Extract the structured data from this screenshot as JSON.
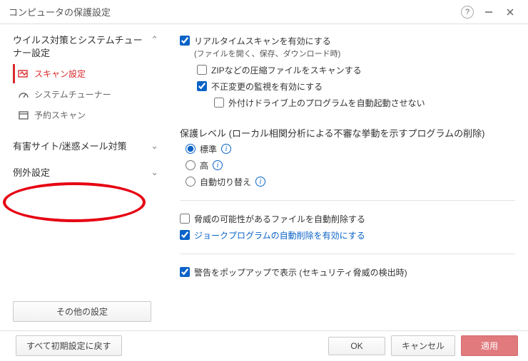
{
  "window": {
    "title": "コンピュータの保護設定"
  },
  "sidebar": {
    "group1": "ウイルス対策とシステムチューナー設定",
    "items": [
      {
        "label": "スキャン設定"
      },
      {
        "label": "システムチューナー"
      },
      {
        "label": "予約スキャン"
      }
    ],
    "group2": "有害サイト/迷惑メール対策",
    "group3": "例外設定",
    "other_button": "その他の設定"
  },
  "main": {
    "realtime": "リアルタイムスキャンを有効にする",
    "realtime_sub": "(ファイルを開く、保存、ダウンロード時)",
    "zip": "ZIPなどの圧縮ファイルをスキャンする",
    "tamper": "不正変更の監視を有効にする",
    "autorun": "外付けドライブ上のプログラムを自動起動させない",
    "level_head": "保護レベル (ローカル相関分析による不審な挙動を示すプログラムの削除)",
    "level_std": "標準",
    "level_high": "高",
    "level_auto": "自動切り替え",
    "auto_delete_threat": "脅威の可能性があるファイルを自動削除する",
    "auto_delete_joke": "ジョークプログラムの自動削除を有効にする",
    "popup_warn": "警告をポップアップで表示 (セキュリティ脅威の検出時)"
  },
  "footer": {
    "reset": "すべて初期設定に戻す",
    "ok": "OK",
    "cancel": "キャンセル",
    "apply": "適用"
  }
}
